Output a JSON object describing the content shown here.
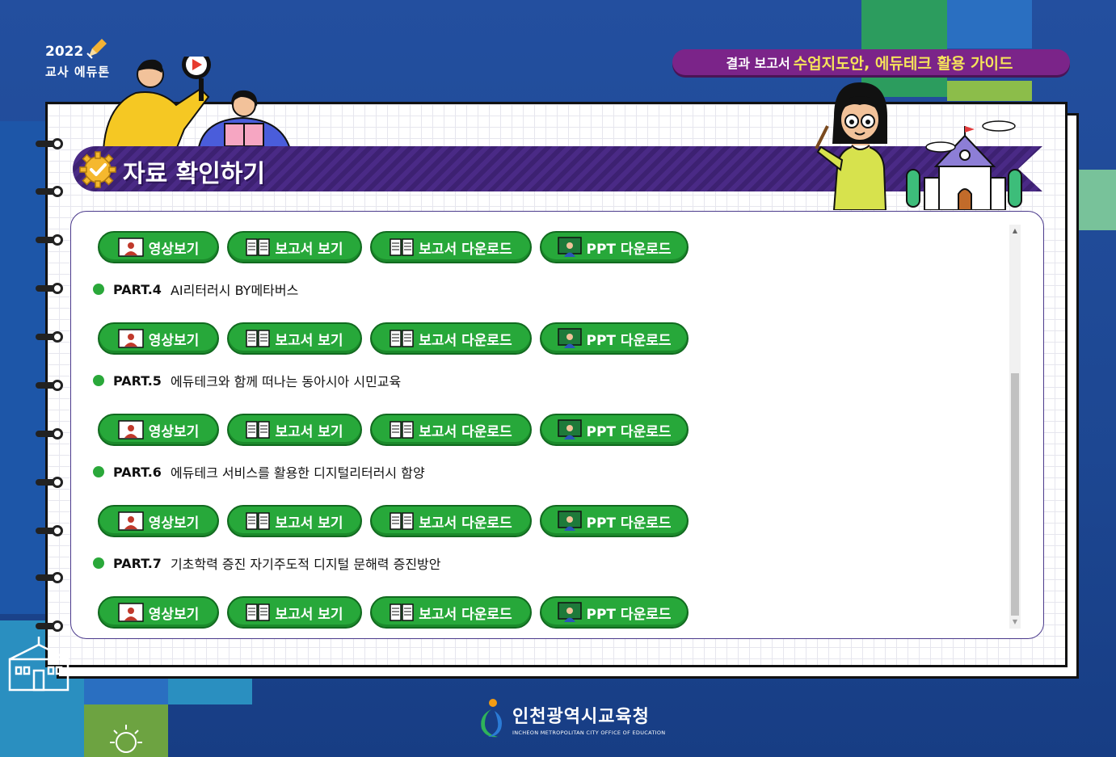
{
  "header": {
    "year": "2022",
    "event_name": "교사 에듀톤",
    "guide_prefix": "결과 보고서",
    "guide_highlight": "수업지도안, 에듀테크 활용 가이드"
  },
  "banner": {
    "title": "자료 확인하기"
  },
  "button_labels": {
    "video": "영상보기",
    "report_view": "보고서 보기",
    "report_download": "보고서 다운로드",
    "ppt_download": "PPT 다운로드"
  },
  "parts": [
    {
      "number": "PART.4",
      "title": "AI리터러시 BY메타버스"
    },
    {
      "number": "PART.5",
      "title": "에듀테크와 함께 떠나는 동아시아 시민교육"
    },
    {
      "number": "PART.6",
      "title": "에듀테크 서비스를 활용한 디지털리터러시 함양"
    },
    {
      "number": "PART.7",
      "title": "기초학력 증진 자기주도적 디지털 문해력 증진방안"
    }
  ],
  "footer": {
    "org_name": "인천광역시교육청",
    "org_english": "INCHEON METROPOLITAN CITY OFFICE OF EDUCATION"
  },
  "colors": {
    "background": "#1f4a96",
    "button_green": "#27a83a",
    "banner_purple": "#4a2a86",
    "pill_purple": "#7b2489",
    "highlight_yellow": "#f5e35a"
  }
}
